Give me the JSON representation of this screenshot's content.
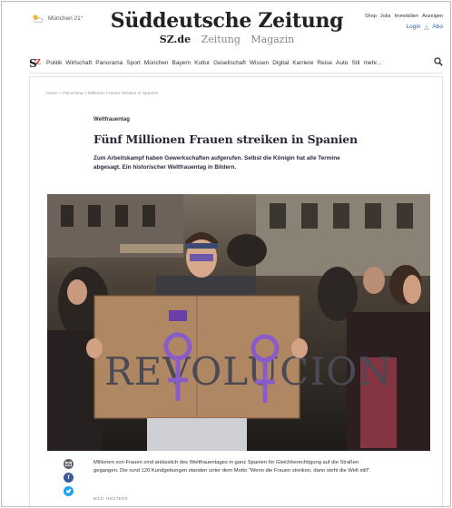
{
  "header": {
    "weather": "München 21°",
    "brand": "Süddeutsche Zeitung",
    "sub_domain": "SZ.de",
    "sub_links": [
      "Zeitung",
      "Magazin"
    ],
    "top_links": [
      "Shop",
      "Jobs",
      "Immobilien",
      "Anzeigen"
    ],
    "login": "Login",
    "abo": "Abo",
    "nav_items": [
      "Politik",
      "Wirtschaft",
      "Panorama",
      "Sport",
      "München",
      "Bayern",
      "Kultur",
      "Gesellschaft",
      "Wissen",
      "Digital",
      "Karriere",
      "Reise",
      "Auto",
      "Stil",
      "mehr..."
    ]
  },
  "article": {
    "breadcrumb": "Home > Panorama > Millionen Frauen streiken in Spanien",
    "kicker": "Weltfrauentag",
    "headline": "Fünf Millionen Frauen streiken in Spanien",
    "teaser": "Zum Arbeitskampf haben Gewerkschaften aufgerufen. Selbst die Königin hat alle Termine abgesagt. Ein historischer Weltfrauentag in Bildern.",
    "photo_sign_text": "REVOLUCION",
    "caption": "Millionen von Frauen sind anlässlich des Weltfrauentages in ganz Spanien für Gleichberechtigung auf die Straßen gegangen. Die rund 120 Kundgebungen standen unter dem Motto \"Wenn die Frauen streiken, dann steht die Welt still\".",
    "credit": "BILD: REUTERS"
  },
  "colors": {
    "text": "#29293a",
    "link": "#2a66b8",
    "facebook": "#3b5998",
    "twitter": "#1da1f2",
    "purple": "#8a5cc9"
  }
}
